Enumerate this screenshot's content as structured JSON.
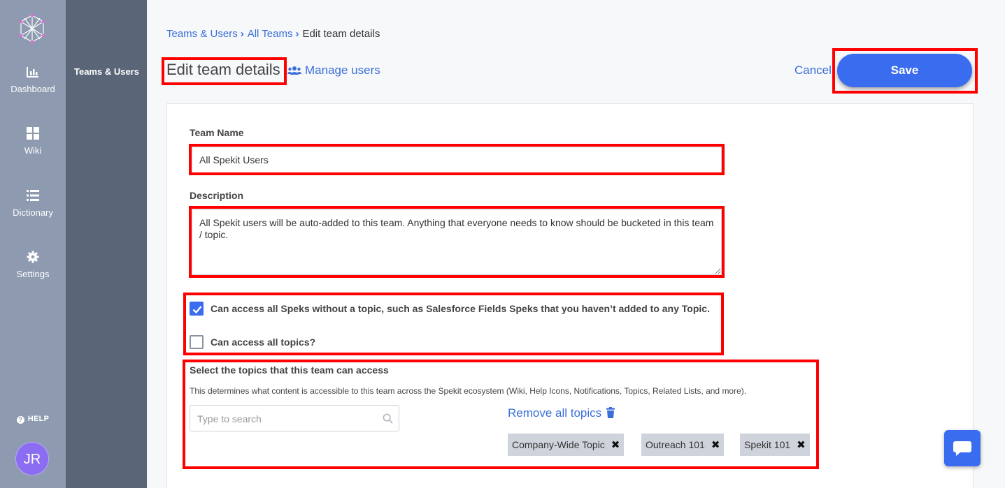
{
  "nav": {
    "items": [
      {
        "label": "Dashboard",
        "icon": "bar-chart-icon"
      },
      {
        "label": "Wiki",
        "icon": "grid-icon"
      },
      {
        "label": "Dictionary",
        "icon": "list-icon"
      },
      {
        "label": "Settings",
        "icon": "gear-icon"
      }
    ],
    "help_label": "HELP",
    "avatar_initials": "JR"
  },
  "subnav": {
    "active_label": "Teams & Users"
  },
  "breadcrumb": {
    "items": [
      "Teams & Users",
      "All Teams",
      "Edit team details"
    ]
  },
  "header": {
    "title": "Edit team details",
    "manage_users_label": "Manage users",
    "cancel_label": "Cancel",
    "save_label": "Save"
  },
  "form": {
    "team_name_label": "Team Name",
    "team_name_value": "All Spekit Users",
    "description_label": "Description",
    "description_value": "All Spekit users will be auto-added to this team. Anything that everyone needs to know should be bucketed in this team / topic.",
    "access_no_topic_label": "Can access all Speks without a topic, such as Salesforce Fields Speks that you haven’t added to any Topic.",
    "access_no_topic_checked": true,
    "access_all_topics_label": "Can access all topics?",
    "access_all_topics_checked": false,
    "topics_heading": "Select the topics that this team can access",
    "topics_hint": "This determines what content is accessible to this team across the Spekit ecosystem (Wiki, Help Icons, Notifications, Topics, Related Lists, and more).",
    "search_placeholder": "Type to search",
    "remove_all_label": "Remove all topics",
    "selected_topics": [
      "Company-Wide Topic",
      "Outreach 101",
      "Spekit 101"
    ]
  },
  "colors": {
    "accent": "#3a6cf0",
    "link": "#3a6fd8",
    "highlight": "#ff0000",
    "rail": "#8d9ab0",
    "subnav": "#5a6678"
  }
}
